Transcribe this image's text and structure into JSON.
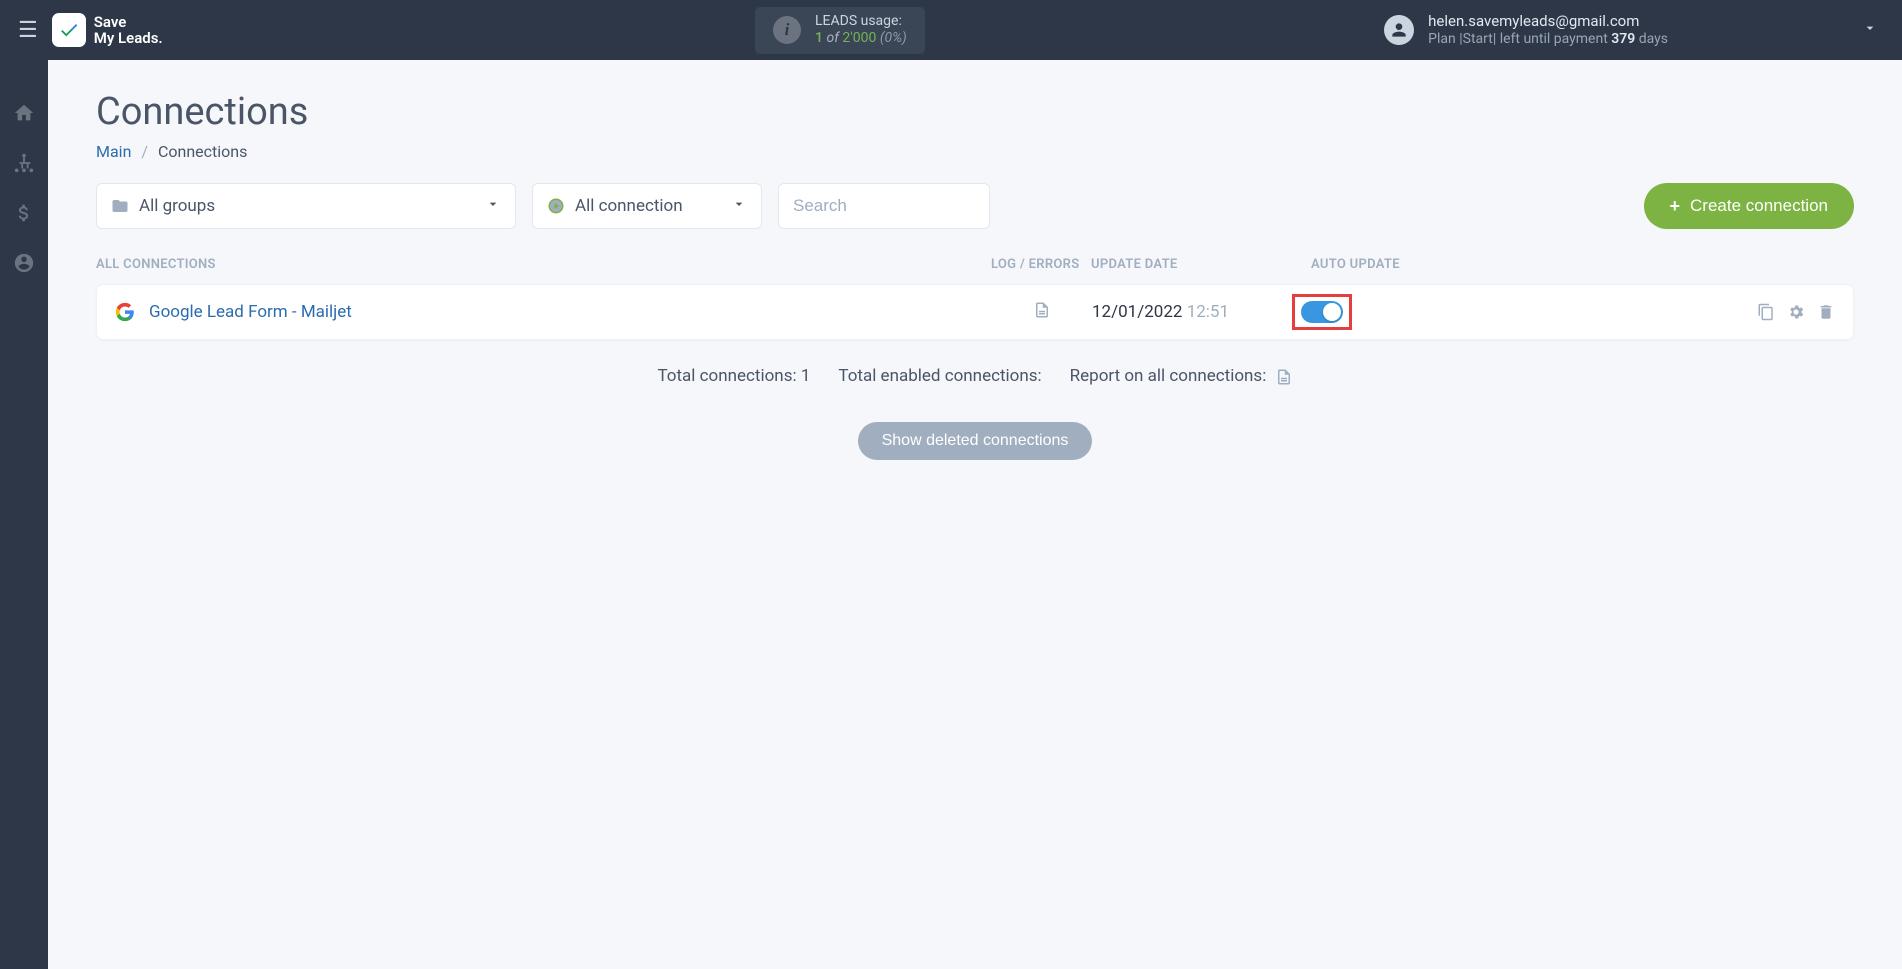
{
  "header": {
    "brand_line1": "Save",
    "brand_line2": "My Leads.",
    "usage": {
      "label": "LEADS usage:",
      "current": "1",
      "of": "of",
      "total": "2'000",
      "pct": "(0%)"
    },
    "user": {
      "email": "helen.savemyleads@gmail.com",
      "plan_prefix": "Plan |Start|  left until payment ",
      "days": "379",
      "days_suffix": " days"
    }
  },
  "page": {
    "title": "Connections",
    "breadcrumb": {
      "main": "Main",
      "current": "Connections"
    }
  },
  "filters": {
    "groups": "All groups",
    "connection": "All connection",
    "search_placeholder": "Search",
    "create_btn": "Create connection"
  },
  "table": {
    "headers": {
      "name": "ALL CONNECTIONS",
      "log": "LOG / ERRORS",
      "date": "UPDATE DATE",
      "auto": "AUTO UPDATE"
    },
    "rows": [
      {
        "name": "Google Lead Form - Mailjet",
        "date": "12/01/2022",
        "time": "12:51",
        "auto_update": true
      }
    ]
  },
  "summary": {
    "total_conn_label": "Total connections: ",
    "total_conn_value": "1",
    "total_enabled_label": "Total enabled connections:",
    "report_label": "Report on all connections:"
  },
  "show_deleted": "Show deleted connections"
}
